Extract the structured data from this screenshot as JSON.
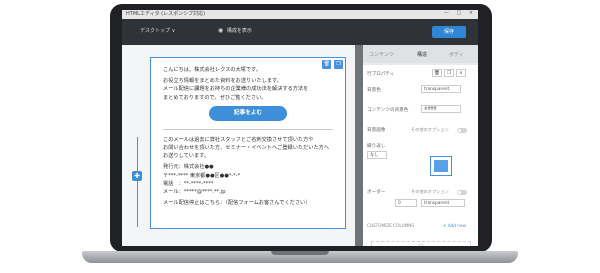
{
  "window": {
    "title": "HTMLエディタ (レスポンシブ対応)",
    "controls": "— □ ×"
  },
  "toolbar": {
    "device_label": "デスクトップ",
    "device_caret": "∨",
    "preview_icon": "eye-icon",
    "preview_label": "構成を表示",
    "save_label": "保存"
  },
  "email": {
    "greeting": "こんにちは。株式会社レクスの大塚です。",
    "para1": [
      "お役立ち情報をまとめた資料をお送りいたします。",
      "メール配信に課題をお持ちの企業様の成功法を解決する方法を",
      "まとめておりますので、ぜひご覧ください。"
    ],
    "cta_label": "記事をよむ",
    "para2": [
      "このメールは過去に弊社スタッフとご名刺交換させて頂いた方や",
      "お問い合わせを頂いた方、セミナー・イベントへご登録いただいた方へ",
      "お送りしています。"
    ],
    "company": "発行元：株式会社●●",
    "address": "〒***-**** 東京都●●区●●*-*-*",
    "phone": "電話　：**-****-****",
    "mail": "メール：*****@****.**.jp",
    "footer": "メール配信停止はこちら：（配信フォームお客さんでください）",
    "block_tools": [
      "🗑",
      "❐"
    ],
    "add_icon": "✚"
  },
  "sidebar": {
    "tabs": [
      "コンテンツ",
      "構造",
      "ボディ"
    ],
    "rows": {
      "row_props": "行プロパティ",
      "bg_label": "背景色",
      "bg_value": "transparent",
      "content_bg_label": "コンテンツの背景色",
      "content_bg_value": "#ffffff",
      "bg_image_label": "背景画像",
      "bg_image_option": "その他のオプション",
      "repeat_label": "繰り返し",
      "repeat_value": "なし",
      "border_label": "ボーダー",
      "border_option": "その他のオプション",
      "border_width": "0",
      "border_color": "transparent",
      "customize_columns": "CUSTOMIZE COLUMNS",
      "add_new": "+ Add new",
      "column_label": "12"
    },
    "icons": [
      "trash-icon",
      "copy-icon",
      "chevron-down-icon"
    ]
  }
}
